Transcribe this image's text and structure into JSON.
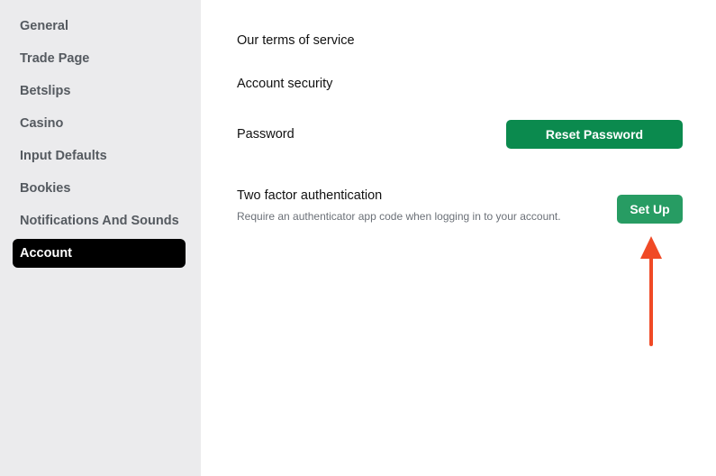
{
  "sidebar": {
    "items": [
      {
        "label": "General",
        "active": false
      },
      {
        "label": "Trade Page",
        "active": false
      },
      {
        "label": "Betslips",
        "active": false
      },
      {
        "label": "Casino",
        "active": false
      },
      {
        "label": "Input Defaults",
        "active": false
      },
      {
        "label": "Bookies",
        "active": false
      },
      {
        "label": "Notifications And Sounds",
        "active": false
      },
      {
        "label": "Account",
        "active": true
      }
    ]
  },
  "account": {
    "terms_label": "Our terms of service",
    "security_label": "Account security",
    "password_label": "Password",
    "reset_password_button": "Reset Password",
    "twofa_title": "Two factor authentication",
    "twofa_description": "Require an authenticator app code when logging in to your account.",
    "setup_button": "Set Up"
  },
  "colors": {
    "sidebar_bg": "#ebebed",
    "active_item_bg": "#000000",
    "reset_button_bg": "#0b8a4e",
    "setup_button_bg": "#279c63",
    "arrow": "#f04a26"
  },
  "icons": {
    "annotation": "up-arrow-icon"
  }
}
